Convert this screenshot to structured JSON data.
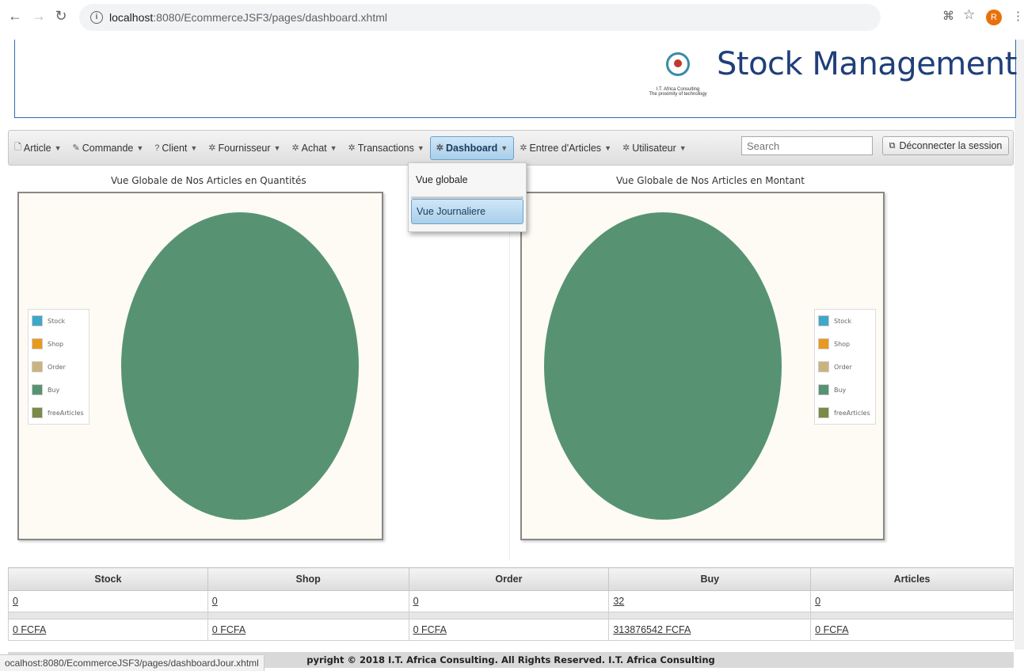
{
  "browser": {
    "url_host": "localhost",
    "url_path": ":8080/EcommerceJSF3/pages/dashboard.xhtml",
    "avatar_letter": "R",
    "status_url": "ocalhost:8080/EcommerceJSF3/pages/dashboardJour.xhtml"
  },
  "header": {
    "title": "Stock Management",
    "logo_line1": "I.T. Africa Consulting",
    "logo_line2": "The proximity of technology"
  },
  "menu": {
    "items": [
      {
        "label": "Article",
        "icon": "file-icon"
      },
      {
        "label": "Commande",
        "icon": "pencil-icon"
      },
      {
        "label": "Client",
        "icon": "question-icon"
      },
      {
        "label": "Fournisseur",
        "icon": "gear-icon"
      },
      {
        "label": "Achat",
        "icon": "gear-icon"
      },
      {
        "label": "Transactions",
        "icon": "gear-icon"
      },
      {
        "label": "Dashboard",
        "icon": "gear-icon"
      },
      {
        "label": "Entree d'Articles",
        "icon": "gear-icon"
      },
      {
        "label": "Utilisateur",
        "icon": "gear-icon"
      }
    ],
    "search_placeholder": "Search",
    "logout_label": "Déconnecter la session",
    "dropdown": [
      "Vue globale",
      "Vue Journaliere"
    ]
  },
  "charts": {
    "left_title": "Vue Globale de Nos Articles en Quantités",
    "right_title": "Vue Globale de Nos Articles en Montant",
    "legend": [
      "Stock",
      "Shop",
      "Order",
      "Buy",
      "freeArticles"
    ]
  },
  "chart_data": [
    {
      "type": "pie",
      "title": "Vue Globale de Nos Articles en Quantités",
      "categories": [
        "Stock",
        "Shop",
        "Order",
        "Buy",
        "freeArticles"
      ],
      "values": [
        0,
        0,
        0,
        32,
        0
      ],
      "colors": [
        "#3fa7c9",
        "#e89a1e",
        "#c9b47f",
        "#579372",
        "#7b8a47"
      ],
      "legend": "left"
    },
    {
      "type": "pie",
      "title": "Vue Globale de Nos Articles en Montant",
      "categories": [
        "Stock",
        "Shop",
        "Order",
        "Buy",
        "freeArticles"
      ],
      "values": [
        0,
        0,
        0,
        313876542,
        0
      ],
      "colors": [
        "#3fa7c9",
        "#e89a1e",
        "#c9b47f",
        "#579372",
        "#7b8a47"
      ],
      "legend": "right"
    }
  ],
  "table": {
    "headers": [
      "Stock",
      "Shop",
      "Order",
      "Buy",
      "Articles"
    ],
    "quantities": [
      "0",
      "0",
      "0",
      "32",
      "0"
    ],
    "amounts": [
      "0 FCFA",
      "0 FCFA",
      "0 FCFA",
      "313876542 FCFA",
      "0 FCFA"
    ]
  },
  "footer": {
    "text": "pyright © 2018 I.T. Africa Consulting. All Rights Reserved. I.T. Africa Consulting"
  }
}
